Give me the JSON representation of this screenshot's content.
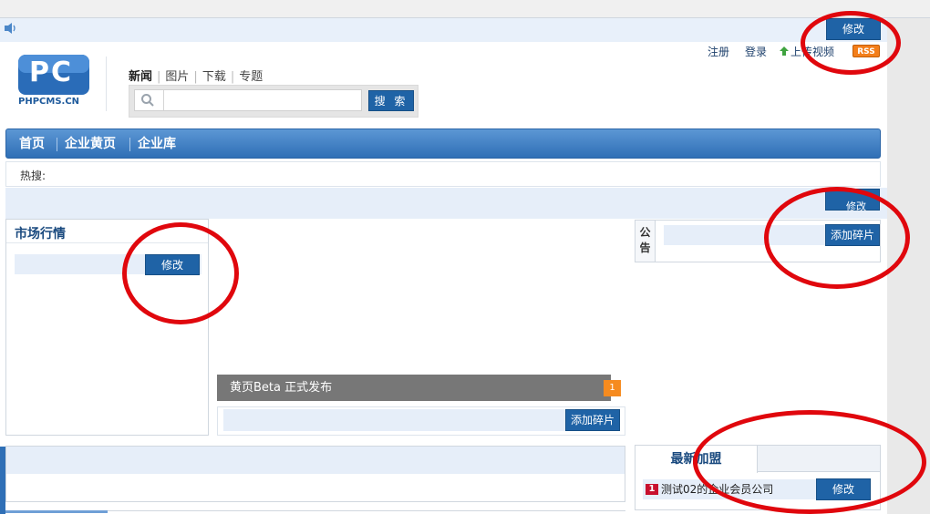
{
  "header": {
    "edit_label": "修改",
    "links": [
      "注册",
      "登录",
      "上传视频"
    ],
    "rss_label": "RSS"
  },
  "logo": {
    "mark": "PC",
    "domain": "PHPCMS.CN"
  },
  "subtabs": [
    "新闻",
    "图片",
    "下载",
    "专题"
  ],
  "search": {
    "placeholder": "",
    "button_label": "搜 索"
  },
  "main_nav": [
    "首页",
    "企业黄页",
    "企业库"
  ],
  "hot_search": {
    "label": "热搜:"
  },
  "wide_edit_label": "修改",
  "left_panel": {
    "title": "市场行情",
    "edit_label": "修改"
  },
  "center": {
    "headline": "黄页Beta 正式发布",
    "badge": "1",
    "add_fragment_label": "添加碎片"
  },
  "announcement": {
    "label": "公告",
    "add_fragment_label": "添加碎片"
  },
  "newest": {
    "tab_label": "最新加盟",
    "items": [
      {
        "rank": "1",
        "name": "测试02的企业会员公司"
      }
    ],
    "edit_label": "修改"
  },
  "colors": {
    "accent_blue": "#1f63a6",
    "nav_blue": "#2f6fb6",
    "slot_blue": "#e6eef9",
    "annotation_red": "#e0070d",
    "badge_orange": "#f68b1f"
  },
  "icons": [
    "speaker-icon",
    "search-icon",
    "upload-icon"
  ]
}
